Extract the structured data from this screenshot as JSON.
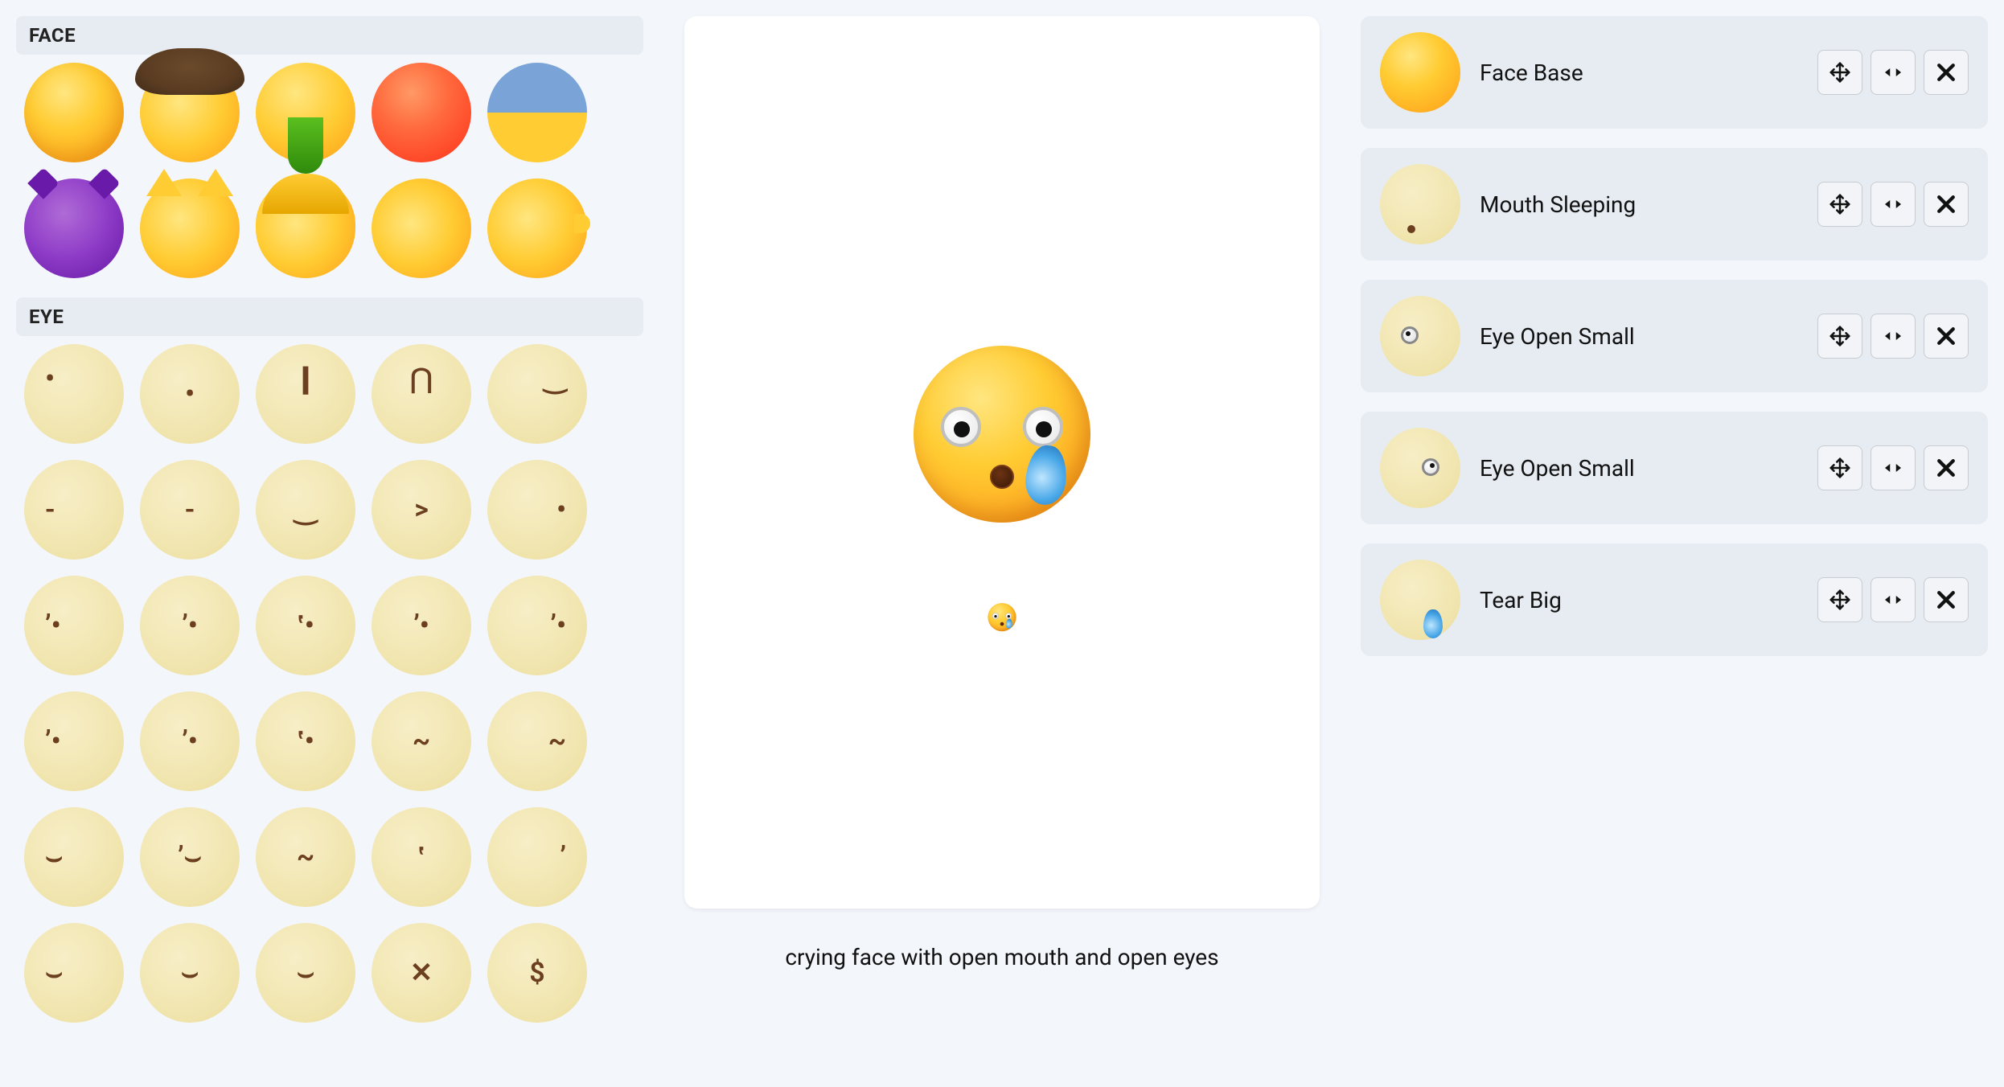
{
  "sections": {
    "face_header": "FACE",
    "eye_header": "EYE"
  },
  "face_palette": [
    {
      "id": "face-base",
      "name": "Face Base"
    },
    {
      "id": "face-cowboy",
      "name": "Face Cowboy"
    },
    {
      "id": "face-vomit",
      "name": "Face Vomiting"
    },
    {
      "id": "face-angry",
      "name": "Face Angry Red"
    },
    {
      "id": "face-half",
      "name": "Face Two Tone"
    },
    {
      "id": "face-imp",
      "name": "Face Imp"
    },
    {
      "id": "face-cat",
      "name": "Face Cat"
    },
    {
      "id": "face-person1",
      "name": "Face Person Hair"
    },
    {
      "id": "face-person2",
      "name": "Face Person"
    },
    {
      "id": "face-head",
      "name": "Face Head Silhouette"
    }
  ],
  "eye_palette_rows": [
    [
      {
        "mark": "•",
        "pos": "tl"
      },
      {
        "mark": "•",
        "pos": "mc"
      },
      {
        "mark": "❙",
        "pos": "tc"
      },
      {
        "mark": "⋂",
        "pos": "tc"
      },
      {
        "mark": "‿",
        "pos": "tr"
      }
    ],
    [
      {
        "mark": "-",
        "pos": "ml"
      },
      {
        "mark": "-",
        "pos": "mc"
      },
      {
        "mark": "‿",
        "pos": "mc"
      },
      {
        "mark": ">",
        "pos": "mc"
      },
      {
        "mark": "•",
        "pos": "mr"
      }
    ],
    [
      {
        "mark": "ʼ•",
        "pos": "ml"
      },
      {
        "mark": "ʼ•",
        "pos": "mc"
      },
      {
        "mark": "ʽ•",
        "pos": "mc"
      },
      {
        "mark": "ʼ•",
        "pos": "mc"
      },
      {
        "mark": "ʼ•",
        "pos": "mr"
      }
    ],
    [
      {
        "mark": "ʼ•",
        "pos": "ml"
      },
      {
        "mark": "ʼ•",
        "pos": "mc"
      },
      {
        "mark": "ʽ•",
        "pos": "mc"
      },
      {
        "mark": "~",
        "pos": "mc"
      },
      {
        "mark": "~",
        "pos": "mr"
      }
    ],
    [
      {
        "mark": "⌣",
        "pos": "ml"
      },
      {
        "mark": "ʼ⌣",
        "pos": "mc"
      },
      {
        "mark": "~",
        "pos": "mc"
      },
      {
        "mark": "ʽ",
        "pos": "mc"
      },
      {
        "mark": "ʼ",
        "pos": "mr"
      }
    ],
    [
      {
        "mark": "⌣",
        "pos": "ml"
      },
      {
        "mark": "⌣",
        "pos": "mc"
      },
      {
        "mark": "⌣",
        "pos": "mc"
      },
      {
        "mark": "✕",
        "pos": "mc"
      },
      {
        "mark": "$",
        "pos": "mc"
      }
    ]
  ],
  "canvas_caption": "crying face with open mouth and open eyes",
  "layers": [
    {
      "label": "Face Base",
      "thumb": "face"
    },
    {
      "label": "Mouth Sleeping",
      "thumb": "mouth"
    },
    {
      "label": "Eye Open Small",
      "thumb": "eye"
    },
    {
      "label": "Eye Open Small",
      "thumb": "eye2"
    },
    {
      "label": "Tear Big",
      "thumb": "tear"
    }
  ],
  "controls": {
    "move_tooltip": "Move",
    "flip_tooltip": "Flip",
    "remove_tooltip": "Remove"
  }
}
